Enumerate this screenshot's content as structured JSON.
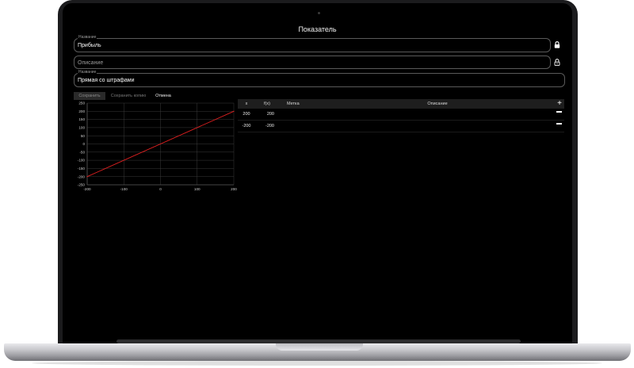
{
  "app": {
    "title": "Показатель"
  },
  "fields": {
    "name": {
      "label": "Название",
      "value": "Прибыль",
      "locked": true
    },
    "description": {
      "placeholder": "Описание",
      "value": "",
      "locked": false
    },
    "curve_name": {
      "label": "Название",
      "value": "Прямая со штрафами"
    }
  },
  "tabs": {
    "save": "Сохранить",
    "save_copy": "Сохранить копию",
    "cancel": "Отмена"
  },
  "table": {
    "headers": {
      "x": "x",
      "fx": "f(x)",
      "label": "Метка",
      "description": "Описание"
    },
    "rows": [
      {
        "x": "200",
        "fx": "200",
        "label": "",
        "description": ""
      },
      {
        "x": "-200",
        "fx": "-200",
        "label": "",
        "description": ""
      }
    ],
    "add_icon": "plus-icon",
    "remove_icon": "minus-icon"
  },
  "chart_data": {
    "type": "line",
    "xlim": [
      -200,
      200
    ],
    "ylim": [
      -250,
      250
    ],
    "x_ticks": [
      -200,
      -100,
      0,
      100,
      200
    ],
    "y_ticks": [
      250,
      200,
      150,
      100,
      50,
      0,
      -50,
      -100,
      -150,
      -200,
      -250
    ],
    "grid": true,
    "series": [
      {
        "x": [
          -200,
          200
        ],
        "y": [
          -200,
          200
        ],
        "color": "#e02020"
      }
    ]
  }
}
